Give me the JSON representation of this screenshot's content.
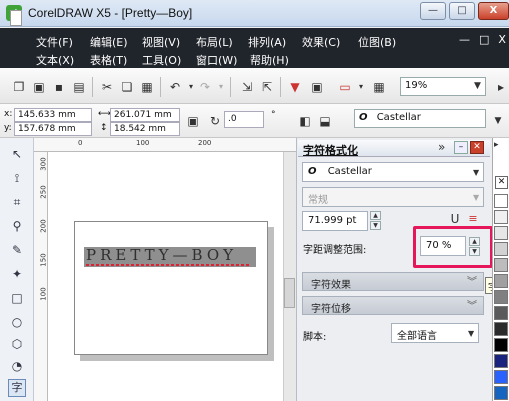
{
  "window": {
    "app_icon": "CorelDRAW-app-icon",
    "title": "CorelDRAW X5 - [Pretty—Boy]",
    "minimize": "—",
    "maximize": "□",
    "close": "X"
  },
  "menu": {
    "row1": [
      "文件(F)",
      "编辑(E)",
      "视图(V)",
      "布局(L)",
      "排列(A)",
      "效果(C)",
      "位图(B)"
    ],
    "row2": [
      "文本(X)",
      "表格(T)",
      "工具(O)",
      "窗口(W)",
      "帮助(H)"
    ],
    "mdi_buttons": [
      "—",
      "□",
      "X"
    ]
  },
  "toolbar": {
    "zoom_value": "19%"
  },
  "property_bar": {
    "x_label": "x:",
    "x_value": "145.633 mm",
    "y_label": "y:",
    "y_value": "157.678 mm",
    "width_value": "261.071 mm",
    "height_value": "18.542 mm",
    "rotation_value": ".0",
    "degree": "°",
    "font_icon": "O",
    "font_name": "Castellar"
  },
  "rulers": {
    "top_ticks": [
      "0",
      "100",
      "200"
    ],
    "left_ticks": [
      "300",
      "250",
      "200",
      "150",
      "100"
    ]
  },
  "canvas": {
    "art_text": "PRETTY—BOY"
  },
  "docker": {
    "title": "字符格式化",
    "expand_icon": "»",
    "font_icon": "O",
    "font_name": "Castellar",
    "style": "常规",
    "size": "71.999 pt",
    "spacing_label": "字距调整范围:",
    "spacing_value": "70 %",
    "section_effects": "字符效果",
    "section_offset": "字符位移",
    "script_label": "脚本:",
    "script_value": "全部语言"
  },
  "tooltip": {
    "text": "字距调整范围"
  },
  "palette": {
    "colors": [
      "#ffffff",
      "#f0f0f0",
      "#e6e6e6",
      "#d2d2d2",
      "#bcbcbc",
      "#a0a0a0",
      "#808080",
      "#5a5a5a",
      "#2b2b2b",
      "#000000",
      "#1a237e",
      "#2962ff",
      "#1565c0"
    ]
  }
}
